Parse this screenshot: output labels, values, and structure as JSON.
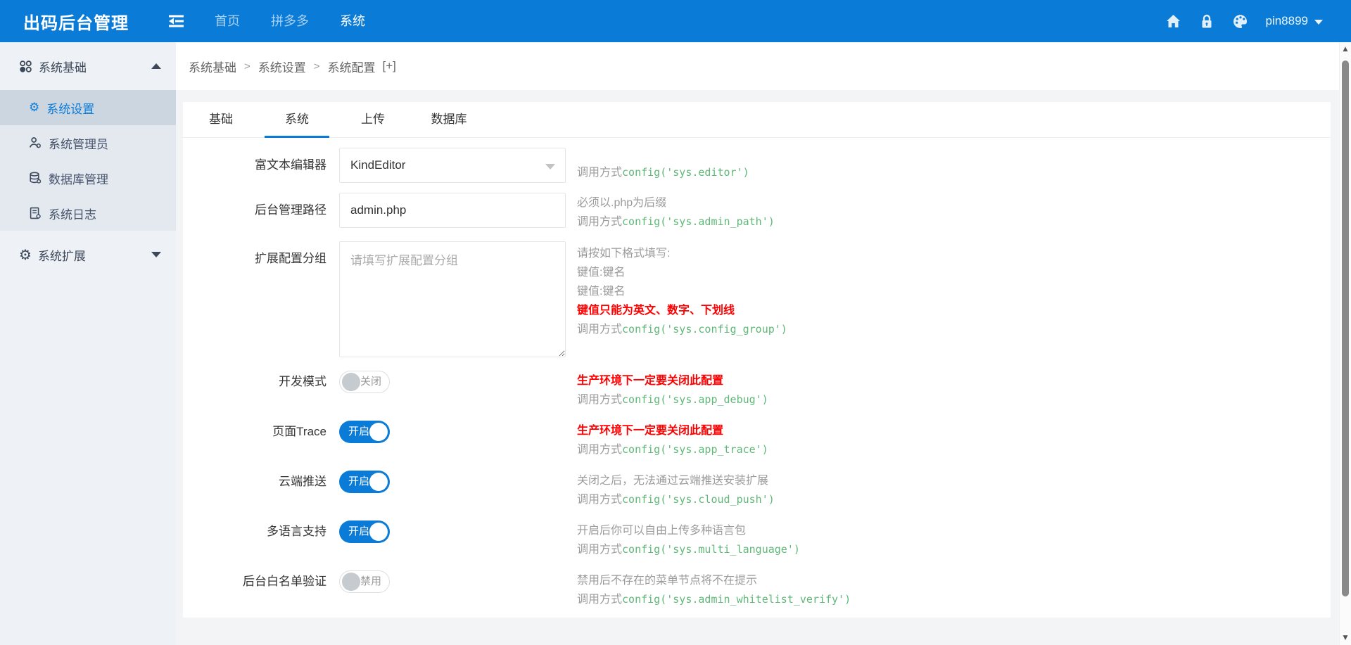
{
  "colors": {
    "navbar_blue": "#0b7bd8",
    "accent_green": "#5FB878",
    "warning_red": "#ff0000",
    "sidebar_selected": "#ccd6e0"
  },
  "navbar": {
    "title": "出码后台管理",
    "menu": [
      {
        "label": "首页",
        "active": false
      },
      {
        "label": "拼多多",
        "active": false
      },
      {
        "label": "系统",
        "active": true
      }
    ],
    "username": "pin8899"
  },
  "sidebar": {
    "groups": [
      {
        "label": "系统基础",
        "expanded": true,
        "items": [
          {
            "label": "系统设置",
            "active": true
          },
          {
            "label": "系统管理员",
            "active": false
          },
          {
            "label": "数据库管理",
            "active": false
          },
          {
            "label": "系统日志",
            "active": false
          }
        ]
      },
      {
        "label": "系统扩展",
        "expanded": false,
        "items": []
      }
    ]
  },
  "breadcrumb": {
    "items": [
      "系统基础",
      "系统设置",
      "系统配置"
    ],
    "separator": ">",
    "suffix": "[+]"
  },
  "tabs": [
    {
      "label": "基础",
      "active": false
    },
    {
      "label": "系统",
      "active": true
    },
    {
      "label": "上传",
      "active": false
    },
    {
      "label": "数据库",
      "active": false
    }
  ],
  "form": {
    "rows": [
      {
        "type": "select",
        "label": "富文本编辑器",
        "value": "KindEditor",
        "call_prefix": "调用方式",
        "code": "config('sys.editor')"
      },
      {
        "type": "input",
        "label": "后台管理路径",
        "value": "admin.php",
        "hint": "必须以.php为后缀",
        "call_prefix": "调用方式",
        "code": "config('sys.admin_path')"
      },
      {
        "type": "textarea",
        "label": "扩展配置分组",
        "placeholder": "请填写扩展配置分组",
        "hint1": "请按如下格式填写:",
        "hint2": "键值:键名",
        "hint3": "键值:键名",
        "warning": "键值只能为英文、数字、下划线",
        "call_prefix": "调用方式",
        "code": "config('sys.config_group')"
      },
      {
        "type": "switch",
        "label": "开发模式",
        "on": false,
        "state": "关闭",
        "warning": "生产环境下一定要关闭此配置",
        "call_prefix": "调用方式",
        "code": "config('sys.app_debug')"
      },
      {
        "type": "switch",
        "label": "页面Trace",
        "on": true,
        "state": "开启",
        "warning": "生产环境下一定要关闭此配置",
        "call_prefix": "调用方式",
        "code": "config('sys.app_trace')"
      },
      {
        "type": "switch",
        "label": "云端推送",
        "on": true,
        "state": "开启",
        "hint": "关闭之后，无法通过云端推送安装扩展",
        "call_prefix": "调用方式",
        "code": "config('sys.cloud_push')"
      },
      {
        "type": "switch",
        "label": "多语言支持",
        "on": true,
        "state": "开启",
        "hint": "开启后你可以自由上传多种语言包",
        "call_prefix": "调用方式",
        "code": "config('sys.multi_language')"
      },
      {
        "type": "switch",
        "label": "后台白名单验证",
        "on": false,
        "state": "禁用",
        "hint": "禁用后不存在的菜单节点将不在提示",
        "call_prefix": "调用方式",
        "code": "config('sys.admin_whitelist_verify')"
      }
    ]
  }
}
